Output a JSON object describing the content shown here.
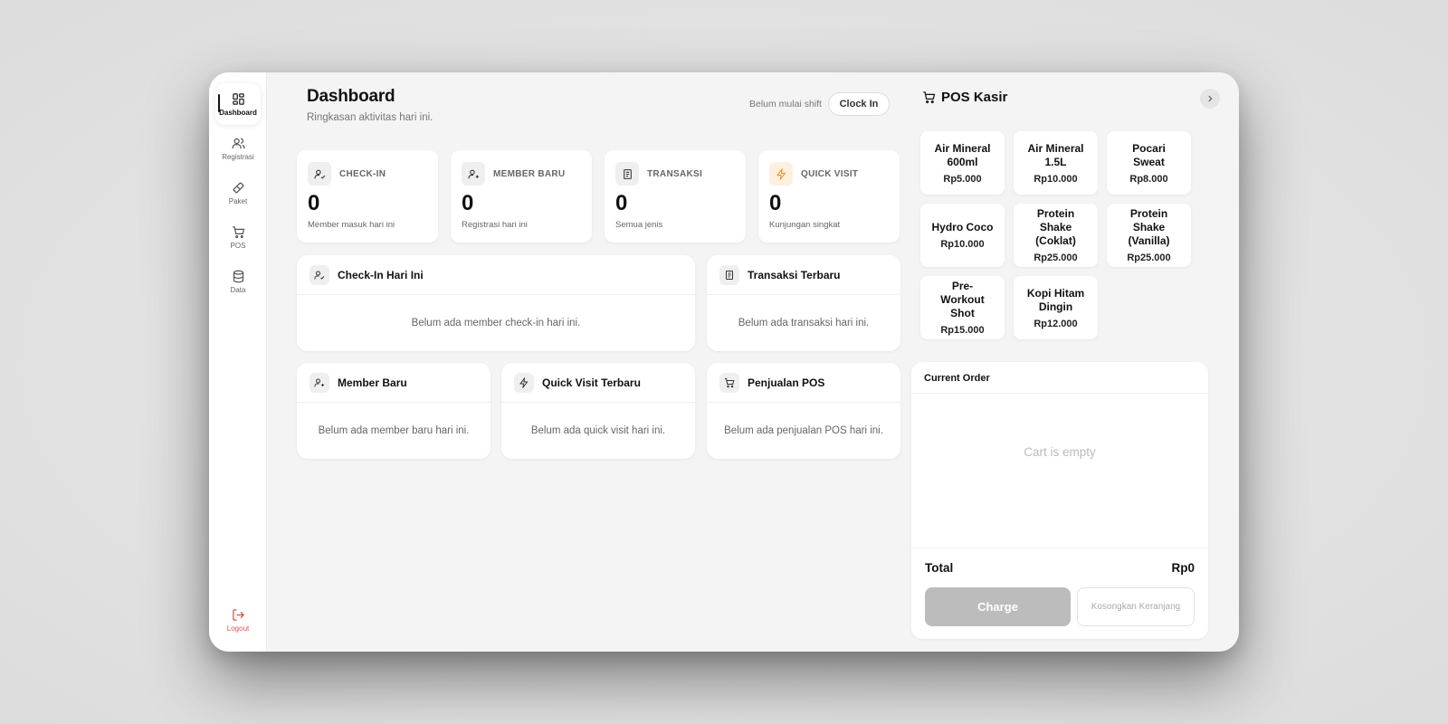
{
  "sidebar": {
    "items": [
      {
        "label": "Dashboard",
        "icon": "dashboard-icon"
      },
      {
        "label": "Registrasi",
        "icon": "users-icon"
      },
      {
        "label": "Paket",
        "icon": "ticket-icon"
      },
      {
        "label": "POS",
        "icon": "cart-icon"
      },
      {
        "label": "Data",
        "icon": "database-icon"
      }
    ],
    "logout": "Logout"
  },
  "header": {
    "title": "Dashboard",
    "subtitle": "Ringkasan aktivitas hari ini.",
    "shift_status": "Belum mulai shift",
    "clock_in": "Clock In"
  },
  "stats": [
    {
      "label": "CHECK-IN",
      "value": "0",
      "sub": "Member masuk hari ini",
      "icon": "user-check-icon"
    },
    {
      "label": "MEMBER BARU",
      "value": "0",
      "sub": "Registrasi hari ini",
      "icon": "user-plus-icon"
    },
    {
      "label": "TRANSAKSI",
      "value": "0",
      "sub": "Semua jenis",
      "icon": "receipt-icon"
    },
    {
      "label": "QUICK VISIT",
      "value": "0",
      "sub": "Kunjungan singkat",
      "icon": "lightning-icon"
    }
  ],
  "cards": {
    "checkin": {
      "title": "Check-In Hari Ini",
      "empty": "Belum ada member check-in hari ini."
    },
    "transaksi": {
      "title": "Transaksi Terbaru",
      "empty": "Belum ada transaksi hari ini."
    },
    "member": {
      "title": "Member Baru",
      "empty": "Belum ada member baru hari ini."
    },
    "quick": {
      "title": "Quick Visit Terbaru",
      "empty": "Belum ada quick visit hari ini."
    },
    "penjualan": {
      "title": "Penjualan POS",
      "empty": "Belum ada penjualan POS hari ini."
    }
  },
  "pos": {
    "title": "POS Kasir",
    "products": [
      {
        "name": "Air Mineral 600ml",
        "price": "Rp5.000"
      },
      {
        "name": "Air Mineral 1.5L",
        "price": "Rp10.000"
      },
      {
        "name": "Pocari Sweat",
        "price": "Rp8.000"
      },
      {
        "name": "Hydro Coco",
        "price": "Rp10.000"
      },
      {
        "name": "Protein Shake (Coklat)",
        "price": "Rp25.000"
      },
      {
        "name": "Protein Shake (Vanilla)",
        "price": "Rp25.000"
      },
      {
        "name": "Pre-Workout Shot",
        "price": "Rp15.000"
      },
      {
        "name": "Kopi Hitam Dingin",
        "price": "Rp12.000"
      }
    ],
    "order": {
      "title": "Current Order",
      "empty": "Cart is empty",
      "total_label": "Total",
      "total_value": "Rp0",
      "charge": "Charge",
      "clear": "Kosongkan Keranjang"
    }
  },
  "colors": {
    "accent_orange": "#e8962e",
    "logout": "#d9534f",
    "charge_disabled": "#bcbcbc"
  }
}
